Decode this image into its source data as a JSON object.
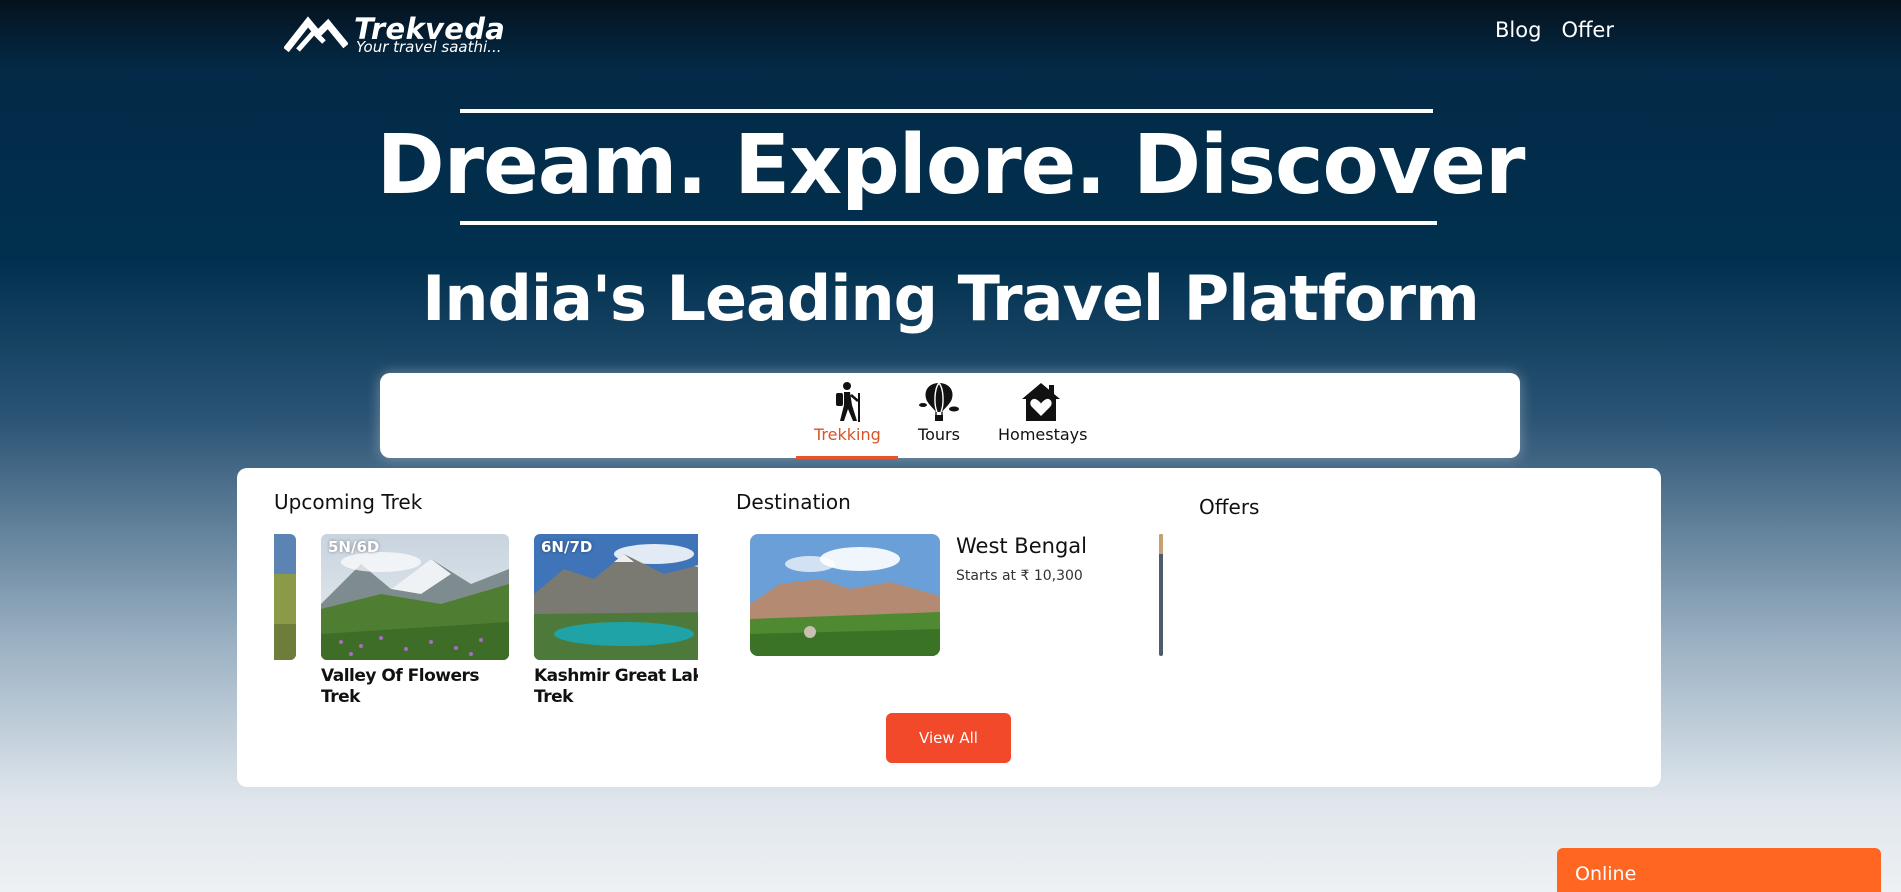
{
  "brand": {
    "name": "Trekveda",
    "tagline": "Your travel saathi..."
  },
  "nav": {
    "items": [
      "Blog",
      "Offer"
    ]
  },
  "hero": {
    "title": "Dream. Explore. Discover",
    "subtitle": "India's Leading Travel Platform"
  },
  "tabs": [
    {
      "label": "Trekking",
      "icon": "hiker-icon",
      "active": true
    },
    {
      "label": "Tours",
      "icon": "hot-air-balloon-icon",
      "active": false
    },
    {
      "label": "Homestays",
      "icon": "house-heart-icon",
      "active": false
    }
  ],
  "panel": {
    "upcoming_title": "Upcoming Trek",
    "destination_title": "Destination",
    "offers_title": "Offers",
    "treks": [
      {
        "badge": "5N/6D",
        "name": "Valley Of Flowers Trek"
      },
      {
        "badge": "6N/7D",
        "name": "Kashmir Great Lake Trek"
      }
    ],
    "destination": {
      "name": "West Bengal",
      "price": "Starts at ₹ 10,300"
    },
    "view_all_label": "View All"
  },
  "chat": {
    "label": "Online"
  },
  "colors": {
    "accent": "#f2492a",
    "active_tab": "#d9532b",
    "chat": "#ff6622",
    "hero_bg": "#01304f"
  }
}
